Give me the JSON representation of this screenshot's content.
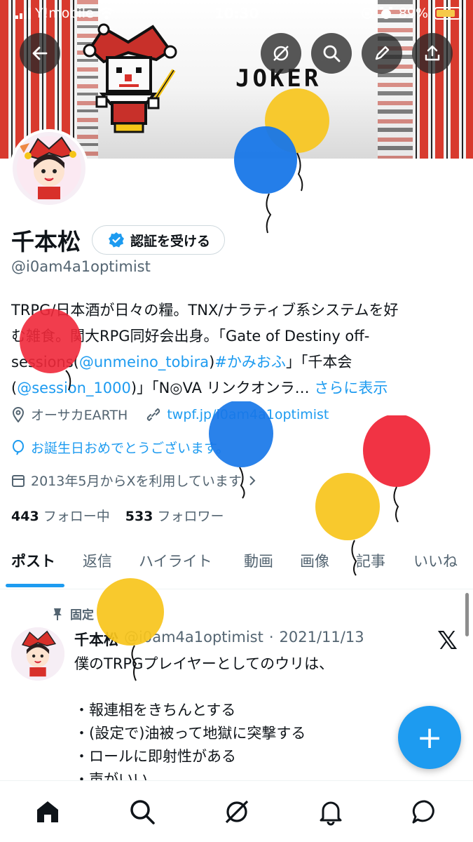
{
  "status_bar": {
    "carrier": "Y!mobile",
    "time": "10:30",
    "battery": "89%"
  },
  "banner": {
    "text": "JOKER"
  },
  "profile": {
    "display_name": "千本松",
    "verify_button": "認証を受ける",
    "handle": "@i0am4a1optimist",
    "bio": {
      "line1": "TRPG/日本酒が日々の糧。TNX/ナラティブ系システムを好",
      "line2": "む雑食。関大RPG同好会出身。「Gate of Destiny off-",
      "line3_a": "sessions(",
      "line3_link1": "@unmeino_tobira",
      "line3_b": ")",
      "line3_link2": "#かみおふ",
      "line3_c": "」「千本会",
      "line4_a": "(",
      "line4_link": "@session_1000",
      "line4_b": ")」「N◎VA リンクオンラ…",
      "show_more": "さらに表示"
    },
    "location": "オーサカEARTH",
    "website": "twpf.jp/i0am4a1optimist",
    "birthday": "お誕生日おめでとうございます。",
    "joined": "2013年5月からXを利用しています",
    "following_count": "443",
    "following_label": "フォロー中",
    "followers_count": "533",
    "followers_label": "フォロワー"
  },
  "tabs": [
    "ポスト",
    "返信",
    "ハイライト",
    "動画",
    "画像",
    "記事",
    "いいね"
  ],
  "active_tab": 0,
  "post": {
    "pinned_label": "固定",
    "author": "千本松",
    "handle": "@i0am4a1optimist",
    "separator": "·",
    "date": "2021/11/13",
    "text": "僕のTRPGプレイヤーとしてのウリは、\n\n・報連相をきちんとする\n・(設定で)油被って地獄に突撃する\n・ロールに即射性がある\n・声がいい"
  },
  "fab_label": "+",
  "colors": {
    "accent": "#1d9bf0",
    "balloon_red": "#f0283a",
    "balloon_yellow": "#f7c51d",
    "balloon_blue": "#1877e8"
  }
}
